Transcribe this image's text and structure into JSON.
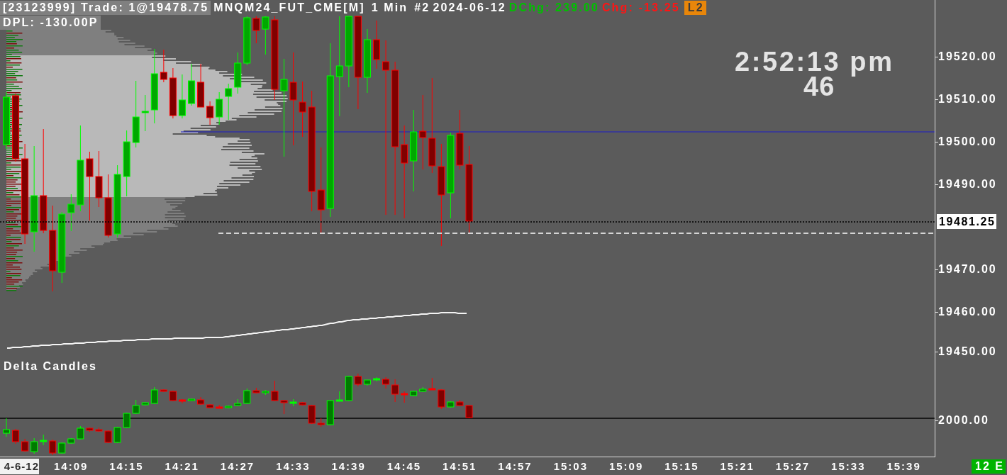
{
  "header": {
    "trade": "[23123999] Trade: 1@19478.75",
    "symbol": "MNQM24_FUT_CME[M]",
    "interval": "1 Min",
    "chart_number": "#2",
    "date": "2024-06-12",
    "daily_change": "DChg: 239.00",
    "change": "Chg: -13.25",
    "badge": "L2",
    "dpl": "DPL: -130.00P"
  },
  "clock": {
    "time": "2:52:13 pm",
    "overlay_number": "46"
  },
  "price_axis": {
    "labels": [
      "19520.00",
      "19510.00",
      "19500.00",
      "19490.00",
      "19470.00",
      "19460.00",
      "19450.00"
    ],
    "current_price": "19481.25"
  },
  "delta_pane": {
    "title": "Delta Candles",
    "axis_label": "2000.00"
  },
  "time_axis": {
    "date_label": "4-6-12",
    "labels": [
      "14:09",
      "14:15",
      "14:21",
      "14:27",
      "14:33",
      "14:39",
      "14:45",
      "14:51",
      "14:57",
      "15:03",
      "15:09",
      "15:15",
      "15:21",
      "15:27",
      "15:33",
      "15:39"
    ],
    "badge": "12 E"
  }
}
